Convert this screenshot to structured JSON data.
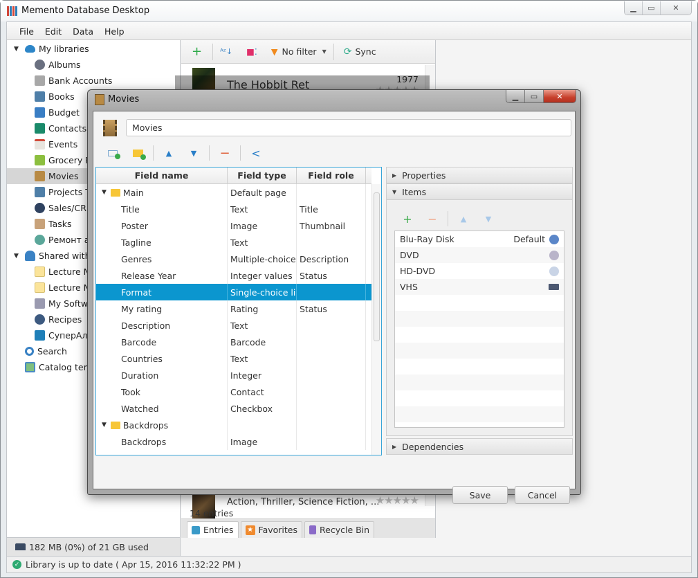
{
  "window": {
    "title": "Memento Database Desktop",
    "controls": [
      "minimize",
      "maximize",
      "close"
    ]
  },
  "menu": [
    "File",
    "Edit",
    "Data",
    "Help"
  ],
  "sidebar": {
    "groups": [
      {
        "label": "My libraries",
        "icon": "cloud-icon",
        "expanded": true
      },
      {
        "label": "Shared with me",
        "icon": "people-icon",
        "expanded": true
      }
    ],
    "my_libraries": [
      {
        "label": "Albums",
        "icon": "album-icon"
      },
      {
        "label": "Bank Accounts",
        "icon": "bank-icon"
      },
      {
        "label": "Books",
        "icon": "book-icon"
      },
      {
        "label": "Budget",
        "icon": "wallet-icon"
      },
      {
        "label": "Contacts",
        "icon": "contacts-icon"
      },
      {
        "label": "Events",
        "icon": "calendar-icon"
      },
      {
        "label": "Grocery Pr",
        "icon": "basket-icon"
      },
      {
        "label": "Movies",
        "icon": "film-icon",
        "selected": true
      },
      {
        "label": "Projects To",
        "icon": "folder-icon"
      },
      {
        "label": "Sales/CRM",
        "icon": "lightning-icon"
      },
      {
        "label": "Tasks",
        "icon": "tasks-icon"
      },
      {
        "label": "Ремонт ав",
        "icon": "wrench-icon"
      }
    ],
    "shared_label": "Shared with m",
    "shared": [
      {
        "label": "Lecture No",
        "icon": "note-icon"
      },
      {
        "label": "Lecture No",
        "icon": "note-icon"
      },
      {
        "label": "My Softwa",
        "icon": "floppy-icon"
      },
      {
        "label": "Recipes",
        "icon": "chef-icon"
      },
      {
        "label": "СуперАльб",
        "icon": "disc-icon"
      }
    ],
    "search_label": "Search",
    "catalog_label": "Catalog temp",
    "storage": "182 MB (0%) of 21 GB used"
  },
  "status": "Library is up to date ( Apr 15, 2016 11:32:22 PM )",
  "entries": {
    "toolbar": {
      "add": "+",
      "sort": "sort-az",
      "group": "group",
      "filter": "No filter",
      "sync": "Sync"
    },
    "first_entry": {
      "title": "The Hobbit Ret",
      "year": "1977",
      "rating": 0
    },
    "last_entry": {
      "title": "Action, Thriller, Science Fiction, ...",
      "rating": 0
    },
    "count": "14 entries",
    "tabs": [
      "Entries",
      "Favorites",
      "Recycle Bin"
    ]
  },
  "dialog": {
    "title": "Movies",
    "library_name": "Movies",
    "columns": [
      "Field name",
      "Field type",
      "Field role"
    ],
    "rows": [
      {
        "name": "Main",
        "type": "Default page",
        "role": "",
        "group": true
      },
      {
        "name": "Title",
        "type": "Text",
        "role": "Title"
      },
      {
        "name": "Poster",
        "type": "Image",
        "role": "Thumbnail"
      },
      {
        "name": "Tagline",
        "type": "Text",
        "role": ""
      },
      {
        "name": "Genres",
        "type": "Multiple-choice...",
        "role": "Description"
      },
      {
        "name": "Release Year",
        "type": "Integer values",
        "role": "Status"
      },
      {
        "name": "Format",
        "type": "Single-choice list",
        "role": "",
        "selected": true
      },
      {
        "name": "My rating",
        "type": "Rating",
        "role": "Status"
      },
      {
        "name": "Description",
        "type": "Text",
        "role": ""
      },
      {
        "name": "Barcode",
        "type": "Barcode",
        "role": ""
      },
      {
        "name": "Countries",
        "type": "Text",
        "role": ""
      },
      {
        "name": "Duration",
        "type": "Integer",
        "role": ""
      },
      {
        "name": "Took",
        "type": "Contact",
        "role": ""
      },
      {
        "name": "Watched",
        "type": "Checkbox",
        "role": ""
      },
      {
        "name": "Backdrops",
        "type": "",
        "role": "",
        "group": true
      },
      {
        "name": "Backdrops",
        "type": "Image",
        "role": ""
      }
    ],
    "sections": {
      "properties": "Properties",
      "items": "Items",
      "dependencies": "Dependencies"
    },
    "items": [
      {
        "label": "Blu-Ray Disk",
        "default": "Default",
        "icon": "bluray-icon",
        "color": "#5a86c8"
      },
      {
        "label": "DVD",
        "default": "",
        "icon": "dvd-icon",
        "color": "#b9b4c9"
      },
      {
        "label": "HD-DVD",
        "default": "",
        "icon": "hddvd-icon",
        "color": "#c9d4e6"
      },
      {
        "label": "VHS",
        "default": "",
        "icon": "vhs-icon",
        "color": "#4b5770"
      }
    ],
    "save": "Save",
    "cancel": "Cancel"
  }
}
